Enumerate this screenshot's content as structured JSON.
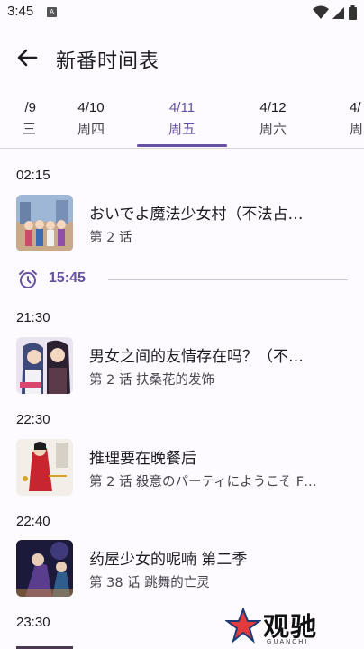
{
  "status_bar": {
    "time": "3:45",
    "notification_badge": "A"
  },
  "header": {
    "title": "新番时间表"
  },
  "tabs": [
    {
      "date": "/9",
      "weekday": "三"
    },
    {
      "date": "4/10",
      "weekday": "周四"
    },
    {
      "date": "4/11",
      "weekday": "周五",
      "active": true
    },
    {
      "date": "4/12",
      "weekday": "周六"
    },
    {
      "date": "4/",
      "weekday": "周"
    }
  ],
  "schedule": [
    {
      "time": "02:15",
      "title": "おいでよ魔法少女村（不法占…",
      "episode": "第 2 话"
    },
    {
      "time": "21:30",
      "title": "男女之间的友情存在吗？（不…",
      "episode": "第 2 话  扶桑花的发饰"
    },
    {
      "time": "22:30",
      "title": "推理要在晚餐后",
      "episode": "第 2 话  殺意のパーティにようこそ F…"
    },
    {
      "time": "22:40",
      "title": "药屋少女的呢喃 第二季",
      "episode": "第 38 话  跳舞的亡灵"
    },
    {
      "time": "23:30"
    }
  ],
  "now_indicator": {
    "time": "15:45"
  },
  "watermark": {
    "text": "观驰",
    "sub": "GUANCHI"
  },
  "colors": {
    "accent": "#6750a4",
    "background": "#fdfbff"
  }
}
